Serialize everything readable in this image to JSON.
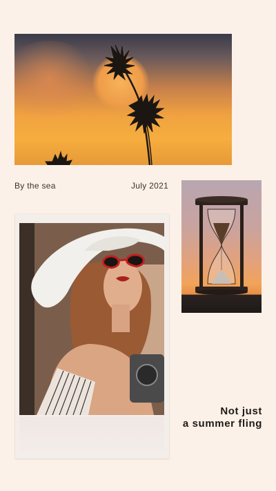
{
  "captions": {
    "location": "By the sea",
    "date": "July 2021"
  },
  "tagline": {
    "line1": "Not just",
    "line2": "a summer fling"
  },
  "colors": {
    "background": "#fcf1e8",
    "text": "#2a2420"
  }
}
